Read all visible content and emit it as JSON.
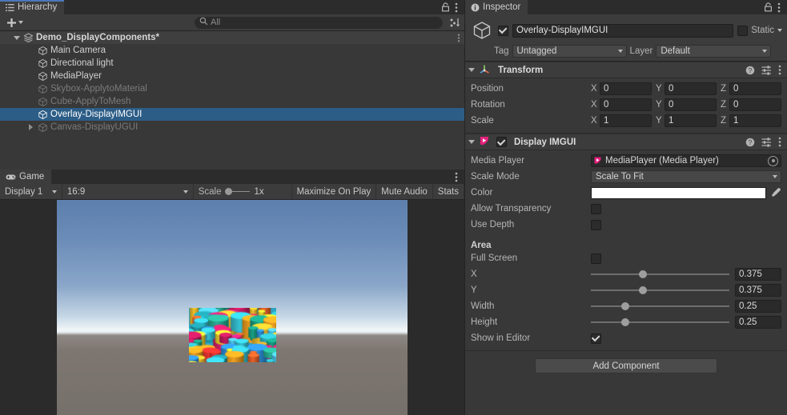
{
  "hierarchy": {
    "tab_label": "Hierarchy",
    "tab_icon": "hierarchy-icon",
    "lock_icon": "lock-icon",
    "menu_icon": "kebab-menu-icon",
    "create_label": "+",
    "sort_icon": "sort-icon",
    "search": {
      "placeholder": "All",
      "value": "",
      "icon": "search-icon"
    },
    "items": [
      {
        "label": "Demo_DisplayComponents*",
        "depth": 0,
        "state": "scene",
        "foldout": "down",
        "icon": "scene-icon"
      },
      {
        "label": "Main Camera",
        "depth": 1,
        "state": "normal",
        "foldout": "none",
        "icon": "gameobject-icon"
      },
      {
        "label": "Directional light",
        "depth": 1,
        "state": "normal",
        "foldout": "none",
        "icon": "gameobject-icon"
      },
      {
        "label": "MediaPlayer",
        "depth": 1,
        "state": "normal",
        "foldout": "none",
        "icon": "gameobject-icon"
      },
      {
        "label": "Skybox-ApplytoMaterial",
        "depth": 1,
        "state": "disabled",
        "foldout": "none",
        "icon": "gameobject-icon"
      },
      {
        "label": "Cube-ApplyToMesh",
        "depth": 1,
        "state": "disabled",
        "foldout": "none",
        "icon": "gameobject-icon"
      },
      {
        "label": "Overlay-DisplayIMGUI",
        "depth": 1,
        "state": "selected",
        "foldout": "none",
        "icon": "gameobject-icon"
      },
      {
        "label": "Canvas-DisplayUGUI",
        "depth": 1,
        "state": "disabled",
        "foldout": "right",
        "icon": "gameobject-icon"
      }
    ]
  },
  "game": {
    "tab_label": "Game",
    "tab_icon": "game-controller-icon",
    "menu_icon": "kebab-menu-icon",
    "display_dropdown": "Display 1",
    "aspect_dropdown": "16:9",
    "scale_label": "Scale",
    "scale_value": "1x",
    "scale_percent": 0,
    "maximize_on_play": "Maximize On Play",
    "mute_audio": "Mute Audio",
    "stats": "Stats",
    "sky_color": "#6b8cb8",
    "horizon_color": "#f2f6f8",
    "ground_color": "#7d7671"
  },
  "inspector": {
    "tab_label": "Inspector",
    "tab_icon": "info-icon",
    "lock_icon": "lock-icon",
    "menu_icon": "kebab-menu-icon",
    "object": {
      "enabled": true,
      "name": "Overlay-DisplayIMGUI",
      "static_label": "Static",
      "static_checked": false,
      "tag_label": "Tag",
      "tag_value": "Untagged",
      "layer_label": "Layer",
      "layer_value": "Default"
    },
    "transform": {
      "title": "Transform",
      "icon": "transform-axis-icon",
      "help_icon": "help-icon",
      "preset_icon": "preset-icon",
      "menu_icon": "kebab-menu-icon",
      "rows": [
        {
          "label": "Position",
          "x": "0",
          "y": "0",
          "z": "0"
        },
        {
          "label": "Rotation",
          "x": "0",
          "y": "0",
          "z": "0"
        },
        {
          "label": "Scale",
          "x": "1",
          "y": "1",
          "z": "1"
        }
      ],
      "axes": [
        "X",
        "Y",
        "Z"
      ]
    },
    "display_imgui": {
      "title": "Display IMGUI",
      "icon": "avpro-media-icon",
      "enabled": true,
      "help_icon": "help-icon",
      "preset_icon": "preset-icon",
      "menu_icon": "kebab-menu-icon",
      "media_player": {
        "label": "Media Player",
        "value": "MediaPlayer (Media Player)",
        "icon": "avpro-media-icon",
        "picker_icon": "object-picker-icon"
      },
      "scale_mode": {
        "label": "Scale Mode",
        "value": "Scale To Fit"
      },
      "color": {
        "label": "Color",
        "value": "#FFFFFF",
        "eyedropper_icon": "eyedropper-icon"
      },
      "allow_transparency": {
        "label": "Allow Transparency",
        "checked": false
      },
      "use_depth": {
        "label": "Use Depth",
        "checked": false
      },
      "area_title": "Area",
      "full_screen": {
        "label": "Full Screen",
        "checked": false
      },
      "sliders": [
        {
          "label": "X",
          "value": "0.375",
          "percent": 37.5
        },
        {
          "label": "Y",
          "value": "0.375",
          "percent": 37.5
        },
        {
          "label": "Width",
          "value": "0.25",
          "percent": 25
        },
        {
          "label": "Height",
          "value": "0.25",
          "percent": 25
        }
      ],
      "show_in_editor": {
        "label": "Show in Editor",
        "checked": true
      }
    },
    "add_component_label": "Add Component"
  }
}
